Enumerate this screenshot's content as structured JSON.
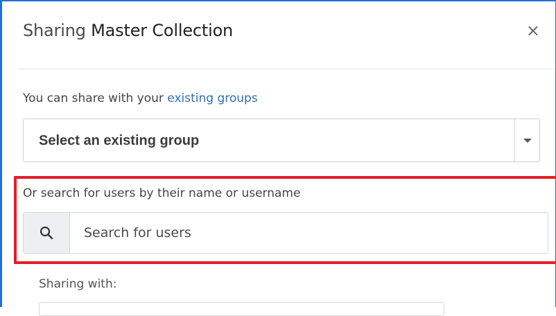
{
  "modal": {
    "title_prefix": "Sharing",
    "title_name": "Master Collection",
    "close_label": "×"
  },
  "share_groups": {
    "intro_text": "You can share with your ",
    "intro_link": "existing groups",
    "select_value": "Select an existing group"
  },
  "user_search": {
    "label": "Or search for users by their name or username",
    "placeholder": "Search for users",
    "icon": "search-icon"
  },
  "sharing_with": {
    "label": "Sharing with:"
  },
  "colors": {
    "highlight": "#e0202a",
    "link": "#2f6fb4",
    "frame": "#1f6fd6"
  }
}
